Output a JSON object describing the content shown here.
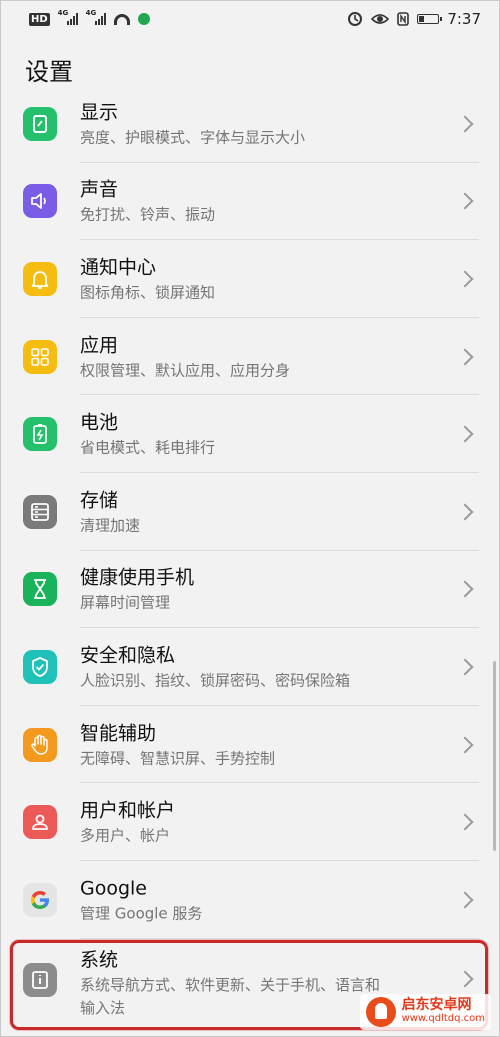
{
  "status_bar": {
    "hd": "HD",
    "net1": "4G",
    "net2": "4G",
    "time": "7:37"
  },
  "header": {
    "title": "设置"
  },
  "items": [
    {
      "title": "显示",
      "subtitle": "亮度、护眼模式、字体与显示大小",
      "icon": "display-icon",
      "color": "#24c06b"
    },
    {
      "title": "声音",
      "subtitle": "免打扰、铃声、振动",
      "icon": "speaker-icon",
      "color": "#7b5ce6"
    },
    {
      "title": "通知中心",
      "subtitle": "图标角标、锁屏通知",
      "icon": "bell-icon",
      "color": "#f5bd12"
    },
    {
      "title": "应用",
      "subtitle": "权限管理、默认应用、应用分身",
      "icon": "apps-grid-icon",
      "color": "#f5bd12"
    },
    {
      "title": "电池",
      "subtitle": "省电模式、耗电排行",
      "icon": "battery-icon",
      "color": "#24c06b"
    },
    {
      "title": "存储",
      "subtitle": "清理加速",
      "icon": "storage-icon",
      "color": "#7a7a7a"
    },
    {
      "title": "健康使用手机",
      "subtitle": "屏幕时间管理",
      "icon": "hourglass-icon",
      "color": "#1bb25c"
    },
    {
      "title": "安全和隐私",
      "subtitle": "人脸识别、指纹、锁屏密码、密码保险箱",
      "icon": "shield-icon",
      "color": "#1fc1b8"
    },
    {
      "title": "智能辅助",
      "subtitle": "无障碍、智慧识屏、手势控制",
      "icon": "hand-icon",
      "color": "#f39a1e"
    },
    {
      "title": "用户和帐户",
      "subtitle": "多用户、帐户",
      "icon": "user-icon",
      "color": "#ec5a57"
    },
    {
      "title": "Google",
      "subtitle": "管理 Google 服务",
      "icon": "google-icon",
      "color": "#e5e5e5"
    },
    {
      "title": "系统",
      "subtitle": "系统导航方式、软件更新、关于手机、语言和",
      "subtitle2": "输入法",
      "icon": "info-icon",
      "color": "#8c8c8c"
    }
  ],
  "watermark": {
    "line1": "启东安卓网",
    "line2": "www.qdltdq.com"
  }
}
